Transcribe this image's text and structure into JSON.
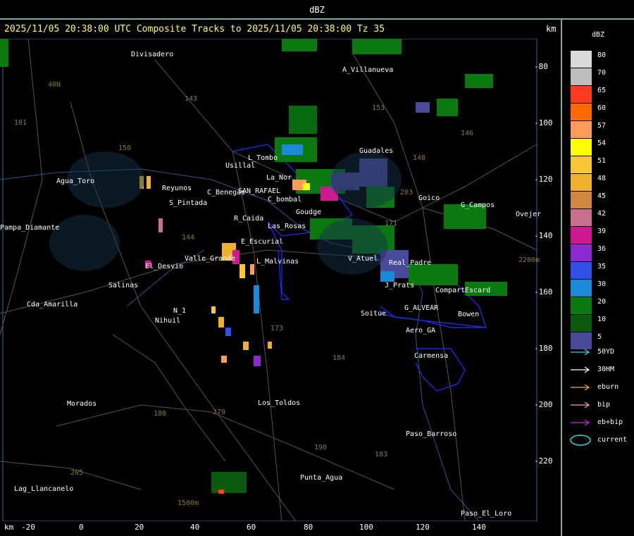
{
  "window": {
    "title": "dBZ"
  },
  "header": {
    "title": "2025/11/05 20:38:00 UTC Composite Tracks to 2025/11/05 20:38:00 Tz 35",
    "units": "km"
  },
  "axes": {
    "y_ticks": [
      "-80",
      "-100",
      "-120",
      "-140",
      "-160",
      "-180",
      "-200",
      "-220"
    ],
    "x_unit": "km",
    "x_ticks": [
      "-20",
      "0",
      "20",
      "40",
      "60",
      "80",
      "100",
      "120",
      "140"
    ]
  },
  "legend": {
    "title": "dBZ",
    "levels": [
      {
        "value": "80",
        "color": "#d9d9d9"
      },
      {
        "value": "70",
        "color": "#bdbdbd"
      },
      {
        "value": "65",
        "color": "#ff3b1f"
      },
      {
        "value": "60",
        "color": "#ff6a00"
      },
      {
        "value": "57",
        "color": "#ff9a5a"
      },
      {
        "value": "54",
        "color": "#ffff00"
      },
      {
        "value": "51",
        "color": "#f7c63a"
      },
      {
        "value": "48",
        "color": "#f0b030"
      },
      {
        "value": "45",
        "color": "#d08840"
      },
      {
        "value": "42",
        "color": "#c87090"
      },
      {
        "value": "39",
        "color": "#d01890"
      },
      {
        "value": "36",
        "color": "#8a2ad0"
      },
      {
        "value": "35",
        "color": "#3050e8"
      },
      {
        "value": "30",
        "color": "#1a8ad8"
      },
      {
        "value": "20",
        "color": "#0a7a10"
      },
      {
        "value": "10",
        "color": "#0a5a10"
      },
      {
        "value": "5",
        "color": "#4a4a9a"
      }
    ],
    "tracks": [
      {
        "label": "50YD",
        "color": "#2ad8d8"
      },
      {
        "label": "30HM",
        "color": "#ffffff"
      },
      {
        "label": "eburn",
        "color": "#f0b030"
      },
      {
        "label": "bip",
        "color": "#f0a0c0"
      },
      {
        "label": "eb+bip",
        "color": "#e020e0"
      },
      {
        "label": "current",
        "color": "#2ad8d8"
      }
    ]
  },
  "places": [
    {
      "name": "Divisadero"
    },
    {
      "name": "A_Villanueva"
    },
    {
      "name": "Guadales"
    },
    {
      "name": "L_Tombo"
    },
    {
      "name": "Usillal"
    },
    {
      "name": "La_Nor"
    },
    {
      "name": "Agua_Toro"
    },
    {
      "name": "Reyunos"
    },
    {
      "name": "S_Pintada"
    },
    {
      "name": "C_Benegas"
    },
    {
      "name": "SAN_RAFAEL"
    },
    {
      "name": "C_bombal"
    },
    {
      "name": "R_Caida"
    },
    {
      "name": "Las_Rosas"
    },
    {
      "name": "Goudge"
    },
    {
      "name": "Pampa_Diamante"
    },
    {
      "name": "E_Escurial"
    },
    {
      "name": "El_Desvio"
    },
    {
      "name": "Valle_Grande"
    },
    {
      "name": "L_Malvinas"
    },
    {
      "name": "Salinas"
    },
    {
      "name": "Cda_Amarilla"
    },
    {
      "name": "N_1"
    },
    {
      "name": "Nihuil"
    },
    {
      "name": "V_Atuel"
    },
    {
      "name": "Real_Padre"
    },
    {
      "name": "J_Prats"
    },
    {
      "name": "Compart"
    },
    {
      "name": "Escard"
    },
    {
      "name": "G_ALVEAR"
    },
    {
      "name": "Bowen"
    },
    {
      "name": "Soitue"
    },
    {
      "name": "Aero_GA"
    },
    {
      "name": "Carmensa"
    },
    {
      "name": "Goico"
    },
    {
      "name": "G_Campos"
    },
    {
      "name": "Ovejer"
    },
    {
      "name": "Morados"
    },
    {
      "name": "Los_Toldos"
    },
    {
      "name": "Paso_Barroso"
    },
    {
      "name": "Punta_Agua"
    },
    {
      "name": "Lag_Llancanelo"
    },
    {
      "name": "Paso_El_Loro"
    }
  ],
  "roads": [
    "40N",
    "143",
    "153",
    "146",
    "101",
    "150",
    "148",
    "203",
    "171",
    "144",
    "173",
    "184",
    "180",
    "179",
    "190",
    "183",
    "205",
    "2200m",
    "1500m"
  ]
}
